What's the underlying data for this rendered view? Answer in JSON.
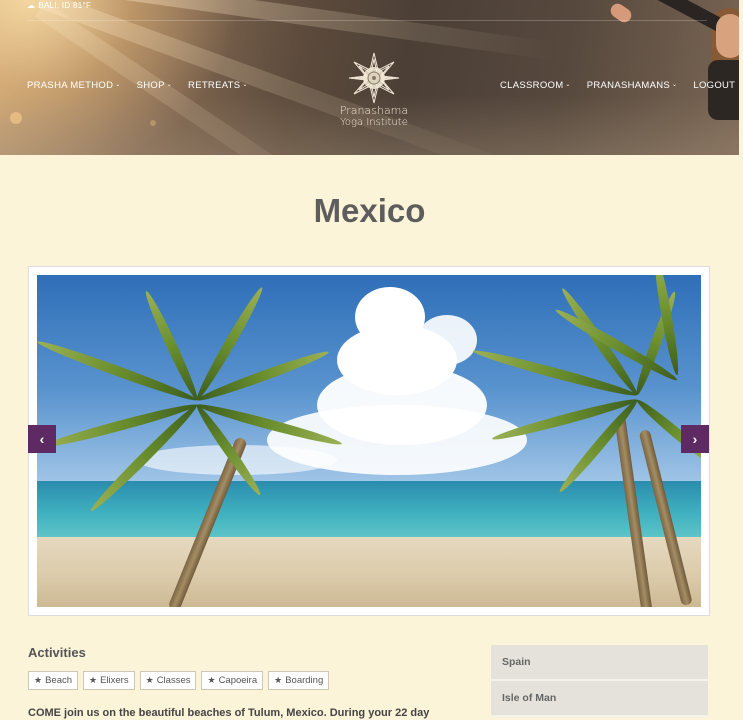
{
  "header": {
    "weather": {
      "icon": "cloud-icon",
      "text": "BALI, ID 81°F"
    },
    "nav_left": [
      {
        "label": "PRASHA METHOD"
      },
      {
        "label": "SHOP"
      },
      {
        "label": "RETREATS"
      }
    ],
    "nav_right": [
      {
        "label": "CLASSROOM"
      },
      {
        "label": "PRANASHAMANS"
      },
      {
        "label": "LOGOUT"
      }
    ],
    "logo": {
      "name": "Pranashama",
      "sub": "Yoga Institute"
    }
  },
  "page": {
    "title": "Mexico"
  },
  "slider": {
    "prev_label": "‹",
    "next_label": "›",
    "arrow_color": "#5e2a63"
  },
  "activities": {
    "heading": "Activities",
    "tags": [
      {
        "label": "Beach"
      },
      {
        "label": "Elixers"
      },
      {
        "label": "Classes"
      },
      {
        "label": "Capoeira"
      },
      {
        "label": "Boarding"
      }
    ],
    "intro": "COME join us on the beautiful beaches of Tulum, Mexico.   During your 22 day"
  },
  "sidebar": {
    "items": [
      {
        "label": "Spain"
      },
      {
        "label": "Isle of Man"
      }
    ]
  }
}
